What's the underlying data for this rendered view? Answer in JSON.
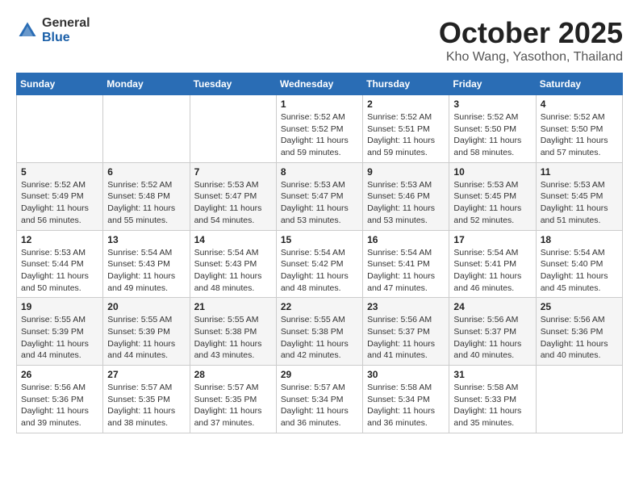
{
  "header": {
    "logo_general": "General",
    "logo_blue": "Blue",
    "month": "October 2025",
    "location": "Kho Wang, Yasothon, Thailand"
  },
  "weekdays": [
    "Sunday",
    "Monday",
    "Tuesday",
    "Wednesday",
    "Thursday",
    "Friday",
    "Saturday"
  ],
  "weeks": [
    [
      {
        "day": "",
        "sunrise": "",
        "sunset": "",
        "daylight": ""
      },
      {
        "day": "",
        "sunrise": "",
        "sunset": "",
        "daylight": ""
      },
      {
        "day": "",
        "sunrise": "",
        "sunset": "",
        "daylight": ""
      },
      {
        "day": "1",
        "sunrise": "Sunrise: 5:52 AM",
        "sunset": "Sunset: 5:52 PM",
        "daylight": "Daylight: 11 hours and 59 minutes."
      },
      {
        "day": "2",
        "sunrise": "Sunrise: 5:52 AM",
        "sunset": "Sunset: 5:51 PM",
        "daylight": "Daylight: 11 hours and 59 minutes."
      },
      {
        "day": "3",
        "sunrise": "Sunrise: 5:52 AM",
        "sunset": "Sunset: 5:50 PM",
        "daylight": "Daylight: 11 hours and 58 minutes."
      },
      {
        "day": "4",
        "sunrise": "Sunrise: 5:52 AM",
        "sunset": "Sunset: 5:50 PM",
        "daylight": "Daylight: 11 hours and 57 minutes."
      }
    ],
    [
      {
        "day": "5",
        "sunrise": "Sunrise: 5:52 AM",
        "sunset": "Sunset: 5:49 PM",
        "daylight": "Daylight: 11 hours and 56 minutes."
      },
      {
        "day": "6",
        "sunrise": "Sunrise: 5:52 AM",
        "sunset": "Sunset: 5:48 PM",
        "daylight": "Daylight: 11 hours and 55 minutes."
      },
      {
        "day": "7",
        "sunrise": "Sunrise: 5:53 AM",
        "sunset": "Sunset: 5:47 PM",
        "daylight": "Daylight: 11 hours and 54 minutes."
      },
      {
        "day": "8",
        "sunrise": "Sunrise: 5:53 AM",
        "sunset": "Sunset: 5:47 PM",
        "daylight": "Daylight: 11 hours and 53 minutes."
      },
      {
        "day": "9",
        "sunrise": "Sunrise: 5:53 AM",
        "sunset": "Sunset: 5:46 PM",
        "daylight": "Daylight: 11 hours and 53 minutes."
      },
      {
        "day": "10",
        "sunrise": "Sunrise: 5:53 AM",
        "sunset": "Sunset: 5:45 PM",
        "daylight": "Daylight: 11 hours and 52 minutes."
      },
      {
        "day": "11",
        "sunrise": "Sunrise: 5:53 AM",
        "sunset": "Sunset: 5:45 PM",
        "daylight": "Daylight: 11 hours and 51 minutes."
      }
    ],
    [
      {
        "day": "12",
        "sunrise": "Sunrise: 5:53 AM",
        "sunset": "Sunset: 5:44 PM",
        "daylight": "Daylight: 11 hours and 50 minutes."
      },
      {
        "day": "13",
        "sunrise": "Sunrise: 5:54 AM",
        "sunset": "Sunset: 5:43 PM",
        "daylight": "Daylight: 11 hours and 49 minutes."
      },
      {
        "day": "14",
        "sunrise": "Sunrise: 5:54 AM",
        "sunset": "Sunset: 5:43 PM",
        "daylight": "Daylight: 11 hours and 48 minutes."
      },
      {
        "day": "15",
        "sunrise": "Sunrise: 5:54 AM",
        "sunset": "Sunset: 5:42 PM",
        "daylight": "Daylight: 11 hours and 48 minutes."
      },
      {
        "day": "16",
        "sunrise": "Sunrise: 5:54 AM",
        "sunset": "Sunset: 5:41 PM",
        "daylight": "Daylight: 11 hours and 47 minutes."
      },
      {
        "day": "17",
        "sunrise": "Sunrise: 5:54 AM",
        "sunset": "Sunset: 5:41 PM",
        "daylight": "Daylight: 11 hours and 46 minutes."
      },
      {
        "day": "18",
        "sunrise": "Sunrise: 5:54 AM",
        "sunset": "Sunset: 5:40 PM",
        "daylight": "Daylight: 11 hours and 45 minutes."
      }
    ],
    [
      {
        "day": "19",
        "sunrise": "Sunrise: 5:55 AM",
        "sunset": "Sunset: 5:39 PM",
        "daylight": "Daylight: 11 hours and 44 minutes."
      },
      {
        "day": "20",
        "sunrise": "Sunrise: 5:55 AM",
        "sunset": "Sunset: 5:39 PM",
        "daylight": "Daylight: 11 hours and 44 minutes."
      },
      {
        "day": "21",
        "sunrise": "Sunrise: 5:55 AM",
        "sunset": "Sunset: 5:38 PM",
        "daylight": "Daylight: 11 hours and 43 minutes."
      },
      {
        "day": "22",
        "sunrise": "Sunrise: 5:55 AM",
        "sunset": "Sunset: 5:38 PM",
        "daylight": "Daylight: 11 hours and 42 minutes."
      },
      {
        "day": "23",
        "sunrise": "Sunrise: 5:56 AM",
        "sunset": "Sunset: 5:37 PM",
        "daylight": "Daylight: 11 hours and 41 minutes."
      },
      {
        "day": "24",
        "sunrise": "Sunrise: 5:56 AM",
        "sunset": "Sunset: 5:37 PM",
        "daylight": "Daylight: 11 hours and 40 minutes."
      },
      {
        "day": "25",
        "sunrise": "Sunrise: 5:56 AM",
        "sunset": "Sunset: 5:36 PM",
        "daylight": "Daylight: 11 hours and 40 minutes."
      }
    ],
    [
      {
        "day": "26",
        "sunrise": "Sunrise: 5:56 AM",
        "sunset": "Sunset: 5:36 PM",
        "daylight": "Daylight: 11 hours and 39 minutes."
      },
      {
        "day": "27",
        "sunrise": "Sunrise: 5:57 AM",
        "sunset": "Sunset: 5:35 PM",
        "daylight": "Daylight: 11 hours and 38 minutes."
      },
      {
        "day": "28",
        "sunrise": "Sunrise: 5:57 AM",
        "sunset": "Sunset: 5:35 PM",
        "daylight": "Daylight: 11 hours and 37 minutes."
      },
      {
        "day": "29",
        "sunrise": "Sunrise: 5:57 AM",
        "sunset": "Sunset: 5:34 PM",
        "daylight": "Daylight: 11 hours and 36 minutes."
      },
      {
        "day": "30",
        "sunrise": "Sunrise: 5:58 AM",
        "sunset": "Sunset: 5:34 PM",
        "daylight": "Daylight: 11 hours and 36 minutes."
      },
      {
        "day": "31",
        "sunrise": "Sunrise: 5:58 AM",
        "sunset": "Sunset: 5:33 PM",
        "daylight": "Daylight: 11 hours and 35 minutes."
      },
      {
        "day": "",
        "sunrise": "",
        "sunset": "",
        "daylight": ""
      }
    ]
  ]
}
